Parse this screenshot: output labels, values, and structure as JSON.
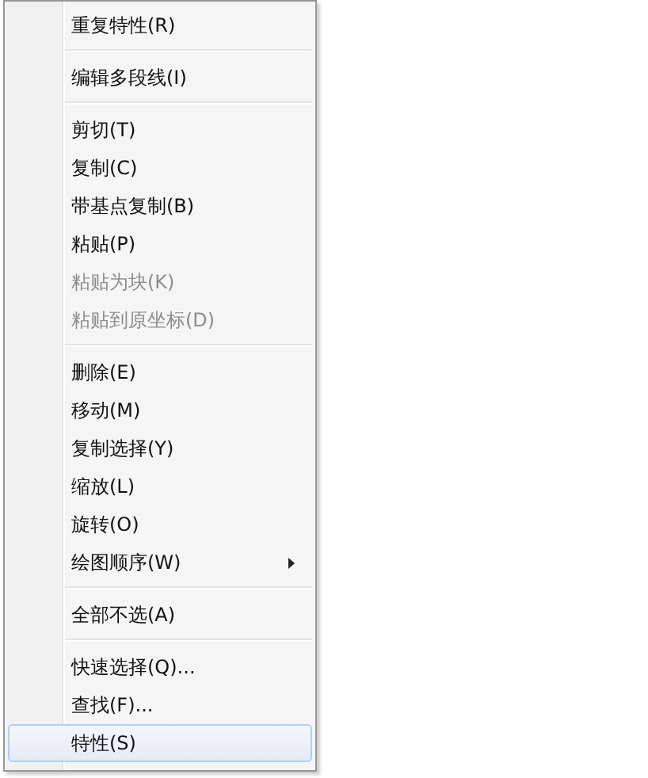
{
  "context_menu": {
    "entries": [
      {
        "kind": "item",
        "label": "重复特性(R)",
        "disabled": false,
        "selected": false,
        "submenu": false
      },
      {
        "kind": "separator"
      },
      {
        "kind": "item",
        "label": "编辑多段线(I)",
        "disabled": false,
        "selected": false,
        "submenu": false
      },
      {
        "kind": "separator"
      },
      {
        "kind": "item",
        "label": "剪切(T)",
        "disabled": false,
        "selected": false,
        "submenu": false
      },
      {
        "kind": "item",
        "label": "复制(C)",
        "disabled": false,
        "selected": false,
        "submenu": false
      },
      {
        "kind": "item",
        "label": "带基点复制(B)",
        "disabled": false,
        "selected": false,
        "submenu": false
      },
      {
        "kind": "item",
        "label": "粘贴(P)",
        "disabled": false,
        "selected": false,
        "submenu": false
      },
      {
        "kind": "item",
        "label": "粘贴为块(K)",
        "disabled": true,
        "selected": false,
        "submenu": false
      },
      {
        "kind": "item",
        "label": "粘贴到原坐标(D)",
        "disabled": true,
        "selected": false,
        "submenu": false
      },
      {
        "kind": "separator"
      },
      {
        "kind": "item",
        "label": "删除(E)",
        "disabled": false,
        "selected": false,
        "submenu": false
      },
      {
        "kind": "item",
        "label": "移动(M)",
        "disabled": false,
        "selected": false,
        "submenu": false
      },
      {
        "kind": "item",
        "label": "复制选择(Y)",
        "disabled": false,
        "selected": false,
        "submenu": false
      },
      {
        "kind": "item",
        "label": "缩放(L)",
        "disabled": false,
        "selected": false,
        "submenu": false
      },
      {
        "kind": "item",
        "label": "旋转(O)",
        "disabled": false,
        "selected": false,
        "submenu": false
      },
      {
        "kind": "item",
        "label": "绘图顺序(W)",
        "disabled": false,
        "selected": false,
        "submenu": true
      },
      {
        "kind": "separator"
      },
      {
        "kind": "item",
        "label": "全部不选(A)",
        "disabled": false,
        "selected": false,
        "submenu": false
      },
      {
        "kind": "separator"
      },
      {
        "kind": "item",
        "label": "快速选择(Q)...",
        "disabled": false,
        "selected": false,
        "submenu": false
      },
      {
        "kind": "item",
        "label": "查找(F)...",
        "disabled": false,
        "selected": false,
        "submenu": false
      },
      {
        "kind": "item",
        "label": "特性(S)",
        "disabled": false,
        "selected": true,
        "submenu": false
      }
    ]
  }
}
